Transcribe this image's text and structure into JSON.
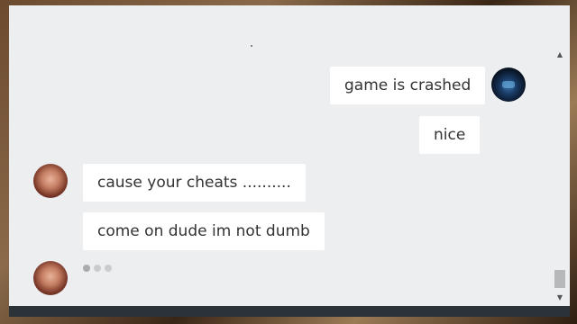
{
  "messages": [
    {
      "text": "game is crashed",
      "sender": "self"
    },
    {
      "text": "nice",
      "sender": "self"
    },
    {
      "text": "cause your cheats ..........",
      "sender": "other"
    },
    {
      "text": "come on dude im not dumb",
      "sender": "other"
    }
  ],
  "typing_indicator": {
    "dots": 3
  },
  "colors": {
    "window_bg": "#eceef0",
    "bubble_bg": "#ffffff",
    "text": "#333333",
    "footer": "#2c3338"
  },
  "icons": {
    "scroll_up": "scroll-up-arrow-icon",
    "scroll_down": "scroll-down-arrow-icon"
  }
}
